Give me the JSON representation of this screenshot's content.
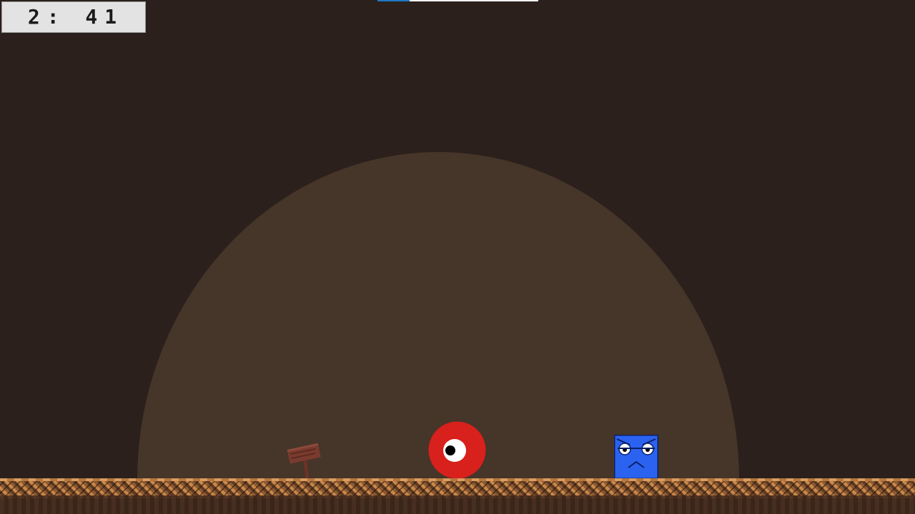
{
  "hud": {
    "timer": "2: 41",
    "progress": 0.2
  },
  "scene": {
    "background_color": "#2b201c",
    "light_dome_color": "#463529",
    "ground_color": "#b5773f"
  },
  "characters": {
    "enemy": {
      "color": "#d8201c",
      "kind": "red-ball-one-eye"
    },
    "player": {
      "color": "#2b63f0",
      "kind": "blue-square-angry-face"
    }
  },
  "props": {
    "sign": {
      "color": "#7a3b2e"
    }
  }
}
